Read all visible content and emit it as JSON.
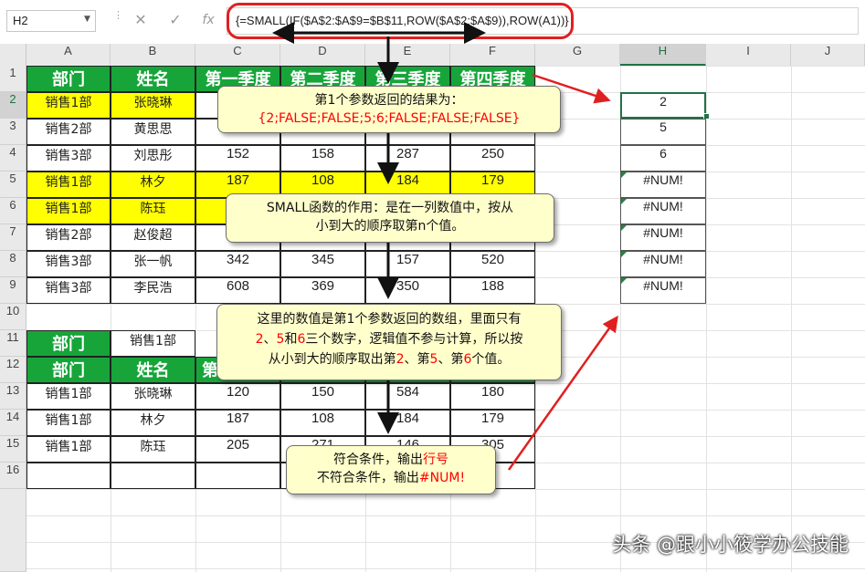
{
  "formula_bar": {
    "name_box": "H2",
    "cancel_icon": "cancel-icon",
    "enter_icon": "enter-icon",
    "fx_label": "fx",
    "formula": "{=SMALL(IF($A$2:$A$9=$B$11,ROW($A$2:$A$9)),ROW(A1))}"
  },
  "columns": [
    "A",
    "B",
    "C",
    "D",
    "E",
    "F",
    "G",
    "H",
    "I",
    "J"
  ],
  "rows": [
    "1",
    "2",
    "3",
    "4",
    "5",
    "6",
    "7",
    "8",
    "9",
    "10",
    "11",
    "12",
    "13",
    "14",
    "15",
    "16"
  ],
  "table": {
    "headers": [
      "部门",
      "姓名",
      "第一季度",
      "第二季度",
      "第三季度",
      "第四季度"
    ],
    "rows": [
      [
        "销售1部",
        "张晓琳",
        "",
        "",
        "",
        ""
      ],
      [
        "销售2部",
        "黄思思",
        "",
        "",
        "",
        ""
      ],
      [
        "销售3部",
        "刘思彤",
        "152",
        "158",
        "287",
        "250"
      ],
      [
        "销售1部",
        "林夕",
        "187",
        "108",
        "184",
        "179"
      ],
      [
        "销售1部",
        "陈珏",
        "",
        "",
        "",
        ""
      ],
      [
        "销售2部",
        "赵俊超",
        "",
        "",
        "",
        ""
      ],
      [
        "销售3部",
        "张一帆",
        "342",
        "345",
        "157",
        "520"
      ],
      [
        "销售3部",
        "李民浩",
        "608",
        "369",
        "350",
        "188"
      ]
    ],
    "highlight_color": "#ffff00",
    "header_color": "#17a53a"
  },
  "criteria": {
    "label": "部门",
    "value": "销售1部"
  },
  "result_table": {
    "headers": [
      "部门",
      "姓名",
      "第"
    ],
    "rows": [
      [
        "销售1部",
        "张晓琳",
        "120",
        "150",
        "584",
        "180"
      ],
      [
        "销售1部",
        "林夕",
        "187",
        "108",
        "184",
        "179"
      ],
      [
        "销售1部",
        "陈珏",
        "205",
        "271",
        "146",
        "305"
      ]
    ]
  },
  "column_h": [
    "2",
    "5",
    "6",
    "#NUM!",
    "#NUM!",
    "#NUM!",
    "#NUM!",
    "#NUM!"
  ],
  "callouts": {
    "c1_line1": "第1个参数返回的结果为：",
    "c1_line2": "{2;FALSE;FALSE;5;6;FALSE;FALSE;FALSE}",
    "c2_line1": "SMALL函数的作用：是在一列数值中，按从",
    "c2_line2": "小到大的顺序取第n个值。",
    "c3_a": "这里的数值是第1个参数返回的数组，里面只有",
    "c3_n1": "2",
    "c3_sep1": "、",
    "c3_n2": "5",
    "c3_and": "和",
    "c3_n3": "6",
    "c3_b": "三个数字，逻辑值不参与计算，所以按",
    "c3_c": "从小到大的顺序取出第",
    "c3_d": "、第",
    "c3_e": "、第",
    "c3_f": "个值。",
    "c4_line1_a": "符合条件，输出",
    "c4_line1_b": "行号",
    "c4_line2_a": "不符合条件，输出",
    "c4_line2_b": "#NUM!"
  },
  "accent_red": "#e02020",
  "watermark": "头条 @跟小小筱学办公技能"
}
